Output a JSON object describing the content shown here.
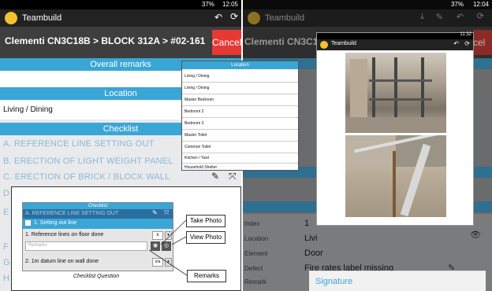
{
  "left": {
    "status": {
      "time": "12:05",
      "battery": "37%"
    },
    "app": {
      "name": "Teambuild"
    },
    "nav": {
      "breadcrumb": "Clementi CN3C18B > BLOCK 312A > #02-161",
      "cancel_label": "Cancel"
    },
    "sections": {
      "overall_remarks": "Overall remarks",
      "location": "Location",
      "location_value": "Living / Dining",
      "checklist": "Checklist"
    },
    "checklist_items": [
      "A.  REFERENCE LINE SETTING OUT",
      "B.  ERECTION OF LIGHT WEIGHT PANEL",
      "C.  ERECTION OF BRICK / BLOCK WALL"
    ],
    "side_letters": [
      "D",
      "E",
      "F",
      "G",
      "H"
    ]
  },
  "location_dropdown": {
    "title": "Location",
    "options": [
      "Living / Dining",
      "Living / Dining",
      "Master Bedroom",
      "Bedroom 2",
      "Bedroom 3",
      "Master Toilet",
      "Common Toilet",
      "Kitchen / Yard",
      "Household Shelter"
    ]
  },
  "checklist_popup": {
    "title": "Checklist",
    "header": "A.  REFERENCE LINE SETTING OUT",
    "subheader": "1.  Setting out line",
    "question1": "1. Reference lines on floor done",
    "q1_value": "x",
    "remarks_placeholder": "Remarks",
    "question2": "2. 1m datum line on wall done",
    "q2_value": "n/a",
    "caption": "Checklist Question"
  },
  "callouts": {
    "take_photo": "Take Photo",
    "view_photo": "View Photo",
    "remarks": "Remarks"
  },
  "right": {
    "status": {
      "time": "12:04",
      "battery": "37%"
    },
    "app": {
      "name": "Teambuild"
    },
    "breadcrumb_partial": "Clementi CN3C18B",
    "cancel_partial": "cel",
    "details": [
      {
        "label": "Index",
        "value": "1"
      },
      {
        "label": "Location",
        "value": "Livi"
      },
      {
        "label": "Element",
        "value": "Door"
      },
      {
        "label": "Defect",
        "value": "Fire rates label missing"
      },
      {
        "label": "Remark",
        "value": ""
      }
    ],
    "signature_label": "Signature"
  },
  "photo_dialog": {
    "time": "11:32",
    "app_name": "Teambuild"
  },
  "colors": {
    "accent": "#3aa6d6",
    "cancel": "#e53935",
    "appbar": "#222222"
  }
}
